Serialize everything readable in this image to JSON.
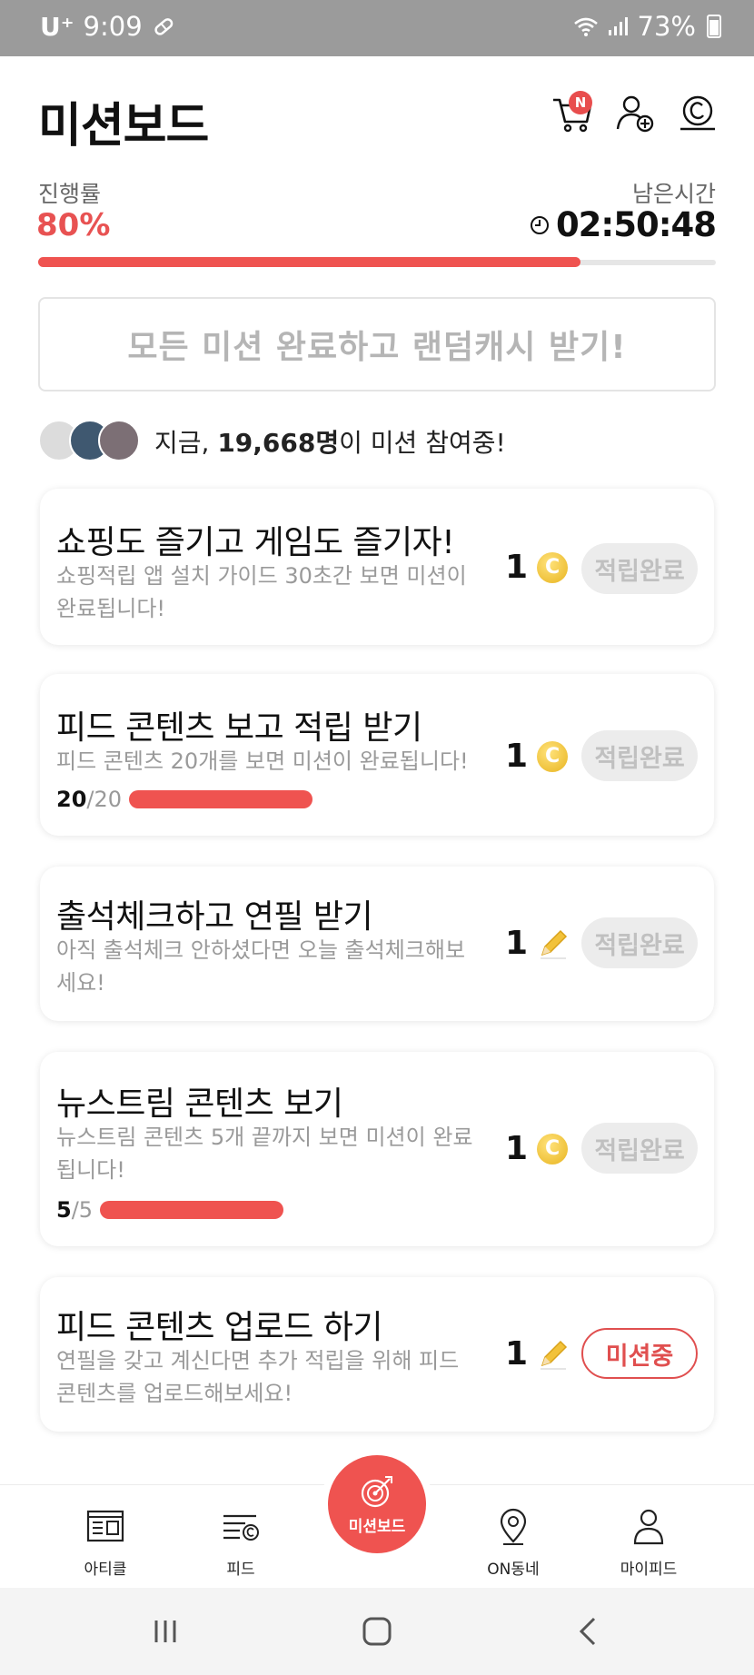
{
  "status_bar": {
    "carrier": "U⁺",
    "time": "9:09",
    "battery": "73%"
  },
  "header": {
    "title": "미션보드",
    "cart_badge": "N"
  },
  "progress": {
    "label": "진행률",
    "value": "80%",
    "fraction": 0.8,
    "remaining_label": "남은시간",
    "remaining_time": "02:50:48"
  },
  "banner": {
    "text": "모든 미션 완료하고 랜덤캐시 받기!"
  },
  "participants": {
    "prefix": "지금, ",
    "count": "19,668명",
    "suffix": "이 미션 참여중!"
  },
  "missions": [
    {
      "title": "쇼핑도 즐기고 게임도 즐기자!",
      "desc": "쇼핑적립 앱 설치 가이드 30초간 보면 미션이 완료됩니다!",
      "reward": "1",
      "reward_icon": "coin-icon",
      "status": "적립완료"
    },
    {
      "title": "피드 콘텐츠 보고 적립 받기",
      "desc": "피드 콘텐츠 20개를 보면 미션이 완료됩니다!",
      "count_done": "20",
      "count_total": "/20",
      "count_fraction": 1.0,
      "reward": "1",
      "reward_icon": "coin-icon",
      "status": "적립완료"
    },
    {
      "title": "출석체크하고 연필 받기",
      "desc": "아직 출석체크 안하셨다면 오늘 출석체크해보세요!",
      "reward": "1",
      "reward_icon": "pencil-icon",
      "status": "적립완료"
    },
    {
      "title": "뉴스트림 콘텐츠 보기",
      "desc": "뉴스트림 콘텐츠 5개 끝까지 보면 미션이 완료됩니다!",
      "count_done": "5",
      "count_total": "/5",
      "count_fraction": 1.0,
      "reward": "1",
      "reward_icon": "coin-icon",
      "status": "적립완료"
    },
    {
      "title": "피드 콘텐츠 업로드 하기",
      "desc": "연필을 갖고 계신다면 추가 적립을 위해 피드 콘텐츠를 업로드해보세요!",
      "reward": "1",
      "reward_icon": "pencil-icon",
      "status": "미션중"
    }
  ],
  "bottom_nav": {
    "items": [
      {
        "label": "아티클",
        "icon": "article-icon"
      },
      {
        "label": "피드",
        "icon": "feed-icon"
      },
      {
        "label": "미션보드",
        "icon": "target-icon"
      },
      {
        "label": "ON동네",
        "icon": "location-pin-icon"
      },
      {
        "label": "마이피드",
        "icon": "person-icon"
      }
    ]
  },
  "colors": {
    "accent": "#ef5350",
    "status_bar": "#9b9b9b",
    "coin": "#e8b420"
  }
}
